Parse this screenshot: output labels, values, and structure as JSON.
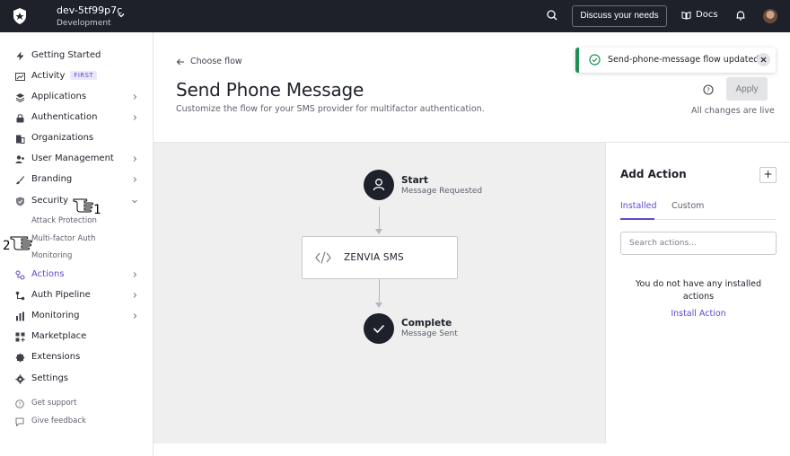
{
  "topbar": {
    "tenant_name": "dev-5tf99p7c",
    "tenant_env": "Development",
    "discuss_label": "Discuss your needs",
    "docs_label": "Docs"
  },
  "sidebar": {
    "items": [
      {
        "label": "Getting Started",
        "icon": "bolt-icon"
      },
      {
        "label": "Activity",
        "badge": "FIRST",
        "icon": "chart-icon"
      },
      {
        "label": "Applications",
        "icon": "layers-icon"
      },
      {
        "label": "Authentication",
        "icon": "lock-icon"
      },
      {
        "label": "Organizations",
        "icon": "building-icon"
      },
      {
        "label": "User Management",
        "icon": "users-icon"
      },
      {
        "label": "Branding",
        "icon": "brush-icon"
      },
      {
        "label": "Security",
        "icon": "shield-icon"
      },
      {
        "label": "Actions",
        "icon": "actions-icon"
      },
      {
        "label": "Auth Pipeline",
        "icon": "pipeline-icon"
      },
      {
        "label": "Monitoring",
        "icon": "bar-chart-icon"
      },
      {
        "label": "Marketplace",
        "icon": "grid-plus-icon"
      },
      {
        "label": "Extensions",
        "icon": "puzzle-icon"
      },
      {
        "label": "Settings",
        "icon": "gear-icon"
      }
    ],
    "security_sub": [
      "Attack Protection",
      "Multi-factor Auth",
      "Monitoring"
    ],
    "footer": [
      {
        "label": "Get support",
        "icon": "help-circle-icon"
      },
      {
        "label": "Give feedback",
        "icon": "chat-icon"
      }
    ]
  },
  "annotations": {
    "hand1": "1",
    "hand2": "2"
  },
  "header": {
    "back_label": "Choose flow",
    "title": "Send Phone Message",
    "subtitle": "Customize the flow for your SMS provider for multifactor authentication.",
    "apply_label": "Apply",
    "status": "All changes are live"
  },
  "toast": {
    "message": "Send-phone-message flow updated"
  },
  "flow": {
    "start": {
      "title": "Start",
      "subtitle": "Message Requested"
    },
    "action": {
      "name": "ZENVIA SMS"
    },
    "complete": {
      "title": "Complete",
      "subtitle": "Message Sent"
    }
  },
  "panel": {
    "title": "Add Action",
    "add_label": "+",
    "tabs": [
      "Installed",
      "Custom"
    ],
    "search_placeholder": "Search actions...",
    "empty_text": "You do not have any installed actions",
    "install_label": "Install Action"
  },
  "colors": {
    "accent": "#5a4bcf",
    "topbar": "#1e212a",
    "success": "#1f8f56",
    "canvas": "#efeff0"
  }
}
